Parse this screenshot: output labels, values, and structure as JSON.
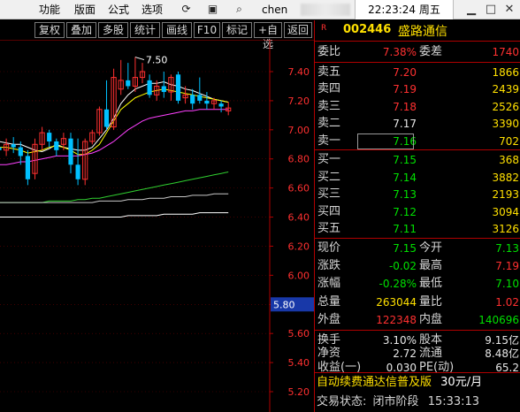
{
  "menu": {
    "items": [
      "功能",
      "版面",
      "公式",
      "选项"
    ],
    "user_text": "chen",
    "clock": "22:23:24 周五"
  },
  "toolbar": [
    "复权",
    "叠加",
    "多股",
    "统计",
    "画线",
    "F10",
    "标记",
    "+自选",
    "返回"
  ],
  "chart_data": {
    "type": "candlestick",
    "y_ticks": [
      "7.40",
      "7.20",
      "7.00",
      "6.80",
      "6.60",
      "6.40",
      "6.20",
      "6.00",
      "5.80",
      "5.60",
      "5.40",
      "5.20"
    ],
    "ylim": [
      5.1,
      7.6
    ],
    "cursor_label": "5.80",
    "high_label": "7.50",
    "candles": [
      {
        "o": 6.88,
        "h": 6.9,
        "l": 6.8,
        "c": 6.86
      },
      {
        "o": 6.86,
        "h": 6.94,
        "l": 6.82,
        "c": 6.9
      },
      {
        "o": 6.9,
        "h": 6.95,
        "l": 6.84,
        "c": 6.88
      },
      {
        "o": 6.88,
        "h": 6.92,
        "l": 6.76,
        "c": 6.82
      },
      {
        "o": 6.82,
        "h": 6.86,
        "l": 6.62,
        "c": 6.66
      },
      {
        "o": 6.7,
        "h": 6.94,
        "l": 6.66,
        "c": 6.9
      },
      {
        "o": 6.9,
        "h": 7.02,
        "l": 6.86,
        "c": 6.98
      },
      {
        "o": 6.98,
        "h": 7.0,
        "l": 6.88,
        "c": 6.92
      },
      {
        "o": 6.92,
        "h": 6.94,
        "l": 6.82,
        "c": 6.86
      },
      {
        "o": 6.9,
        "h": 6.98,
        "l": 6.86,
        "c": 6.94
      },
      {
        "o": 6.94,
        "h": 6.98,
        "l": 6.7,
        "c": 6.76
      },
      {
        "o": 6.76,
        "h": 6.94,
        "l": 6.62,
        "c": 6.66
      },
      {
        "o": 6.66,
        "h": 6.94,
        "l": 6.62,
        "c": 6.92
      },
      {
        "o": 6.92,
        "h": 7.0,
        "l": 6.9,
        "c": 6.98
      },
      {
        "o": 6.98,
        "h": 7.16,
        "l": 6.96,
        "c": 7.14
      },
      {
        "o": 7.14,
        "h": 7.34,
        "l": 7.0,
        "c": 7.02
      },
      {
        "o": 7.02,
        "h": 7.42,
        "l": 7.0,
        "c": 7.36
      },
      {
        "o": 7.28,
        "h": 7.48,
        "l": 7.24,
        "c": 7.34
      },
      {
        "o": 7.34,
        "h": 7.46,
        "l": 7.28,
        "c": 7.3
      },
      {
        "o": 7.3,
        "h": 7.5,
        "l": 7.26,
        "c": 7.36
      },
      {
        "o": 7.36,
        "h": 7.46,
        "l": 7.32,
        "c": 7.4
      },
      {
        "o": 7.34,
        "h": 7.38,
        "l": 7.22,
        "c": 7.24
      },
      {
        "o": 7.24,
        "h": 7.34,
        "l": 7.2,
        "c": 7.3
      },
      {
        "o": 7.3,
        "h": 7.4,
        "l": 7.22,
        "c": 7.26
      },
      {
        "o": 7.26,
        "h": 7.38,
        "l": 7.2,
        "c": 7.36
      },
      {
        "o": 7.38,
        "h": 7.4,
        "l": 7.18,
        "c": 7.2
      },
      {
        "o": 7.22,
        "h": 7.3,
        "l": 7.18,
        "c": 7.24
      },
      {
        "o": 7.24,
        "h": 7.28,
        "l": 7.14,
        "c": 7.18
      },
      {
        "o": 7.24,
        "h": 7.36,
        "l": 7.18,
        "c": 7.2
      },
      {
        "o": 7.2,
        "h": 7.26,
        "l": 7.14,
        "c": 7.18
      },
      {
        "o": 7.18,
        "h": 7.22,
        "l": 7.14,
        "c": 7.2
      },
      {
        "o": 7.18,
        "h": 7.2,
        "l": 7.12,
        "c": 7.16
      },
      {
        "o": 7.13,
        "h": 7.19,
        "l": 7.1,
        "c": 7.15
      }
    ],
    "ma_lines": [
      {
        "color": "#ffffff",
        "points": [
          6.92,
          6.91,
          6.9,
          6.9,
          6.88,
          6.86,
          6.85,
          6.87,
          6.9,
          6.88,
          6.87,
          6.86,
          6.86,
          6.88,
          6.94,
          7.0,
          7.08,
          7.18,
          7.24,
          7.28,
          7.3,
          7.32,
          7.32,
          7.33,
          7.31,
          7.3,
          7.28,
          7.27,
          7.25,
          7.23,
          7.21,
          7.2,
          7.19
        ]
      },
      {
        "color": "#ffff00",
        "points": [
          6.88,
          6.88,
          6.87,
          6.86,
          6.84,
          6.85,
          6.86,
          6.88,
          6.89,
          6.88,
          6.86,
          6.83,
          6.83,
          6.86,
          6.9,
          6.98,
          7.06,
          7.14,
          7.18,
          7.22,
          7.24,
          7.26,
          7.27,
          7.28,
          7.27,
          7.26,
          7.25,
          7.24,
          7.23,
          7.22,
          7.21,
          7.2,
          7.19
        ]
      },
      {
        "color": "#ff40ff",
        "points": [
          6.76,
          6.76,
          6.77,
          6.78,
          6.78,
          6.79,
          6.8,
          6.81,
          6.82,
          6.82,
          6.82,
          6.82,
          6.83,
          6.84,
          6.86,
          6.89,
          6.92,
          6.96,
          7.0,
          7.03,
          7.06,
          7.08,
          7.09,
          7.1,
          7.11,
          7.12,
          7.13,
          7.13,
          7.14,
          7.14,
          7.14,
          7.14,
          7.14
        ]
      },
      {
        "color": "#30d030",
        "points": [
          6.5,
          6.5,
          6.5,
          6.5,
          6.5,
          6.5,
          6.5,
          6.51,
          6.51,
          6.51,
          6.51,
          6.52,
          6.52,
          6.53,
          6.53,
          6.54,
          6.55,
          6.56,
          6.57,
          6.58,
          6.59,
          6.6,
          6.61,
          6.62,
          6.63,
          6.64,
          6.65,
          6.66,
          6.67,
          6.68,
          6.69,
          6.7,
          6.71
        ]
      },
      {
        "color": "#c8c8c8",
        "points": [
          6.5,
          6.5,
          6.5,
          6.5,
          6.5,
          6.5,
          6.5,
          6.5,
          6.5,
          6.5,
          6.5,
          6.5,
          6.5,
          6.5,
          6.51,
          6.51,
          6.51,
          6.51,
          6.52,
          6.52,
          6.52,
          6.53,
          6.53,
          6.53,
          6.54,
          6.54,
          6.54,
          6.55,
          6.55,
          6.55,
          6.56,
          6.56,
          6.56
        ]
      },
      {
        "color": "#ffffff",
        "points": [
          6.4,
          6.4,
          6.4,
          6.4,
          6.4,
          6.4,
          6.4,
          6.4,
          6.4,
          6.4,
          6.4,
          6.4,
          6.4,
          6.4,
          6.4,
          6.4,
          6.4,
          6.4,
          6.41,
          6.41,
          6.41,
          6.41,
          6.41,
          6.42,
          6.42,
          6.42,
          6.42,
          6.42,
          6.43,
          6.43,
          6.43,
          6.43,
          6.43
        ]
      }
    ],
    "colors": {
      "up": "#ff3030",
      "down": "#00c0ff",
      "axis": "#b00000",
      "grid": "#6a0000",
      "tick": "#ff3030"
    }
  },
  "quote": {
    "market_tag": "R",
    "code": "002446",
    "name": "盛路通信",
    "weibi": {
      "label": "委比",
      "value": "7.38%",
      "label2": "委差",
      "value2": "1740"
    },
    "asks": [
      {
        "label": "卖五",
        "price": "7.20",
        "vol": "1866"
      },
      {
        "label": "卖四",
        "price": "7.19",
        "vol": "2439"
      },
      {
        "label": "卖三",
        "price": "7.18",
        "vol": "2526"
      },
      {
        "label": "卖二",
        "price": "7.17",
        "vol": "3390"
      },
      {
        "label": "卖一",
        "price": "7.16",
        "vol": "702"
      }
    ],
    "bids": [
      {
        "label": "买一",
        "price": "7.15",
        "vol": "368"
      },
      {
        "label": "买二",
        "price": "7.14",
        "vol": "3882"
      },
      {
        "label": "买三",
        "price": "7.13",
        "vol": "2193"
      },
      {
        "label": "买四",
        "price": "7.12",
        "vol": "3094"
      },
      {
        "label": "买五",
        "price": "7.11",
        "vol": "3126"
      }
    ],
    "stats": [
      {
        "label": "现价",
        "value": "7.15",
        "label2": "今开",
        "value2": "7.13"
      },
      {
        "label": "涨跌",
        "value": "-0.02",
        "label2": "最高",
        "value2": "7.19"
      },
      {
        "label": "涨幅",
        "value": "-0.28%",
        "label2": "最低",
        "value2": "7.10"
      },
      {
        "label": "总量",
        "value": "263044",
        "label2": "量比",
        "value2": "1.02"
      },
      {
        "label": "外盘",
        "value": "122348",
        "label2": "内盘",
        "value2": "140696"
      }
    ],
    "fundamentals": [
      {
        "label": "换手",
        "value": "3.10%",
        "label2": "股本",
        "value2": "9.15亿"
      },
      {
        "label": "净资",
        "value": "2.72",
        "label2": "流通",
        "value2": "8.48亿"
      },
      {
        "label": "收益(一)",
        "value": "0.030",
        "label2": "PE(动)",
        "value2": "65.2"
      }
    ],
    "ad_text": "自动续费通达信普及版",
    "ad_price": "30元/月",
    "status_label": "交易状态:",
    "status_value": "闭市阶段",
    "status_time": "15:33:13"
  }
}
